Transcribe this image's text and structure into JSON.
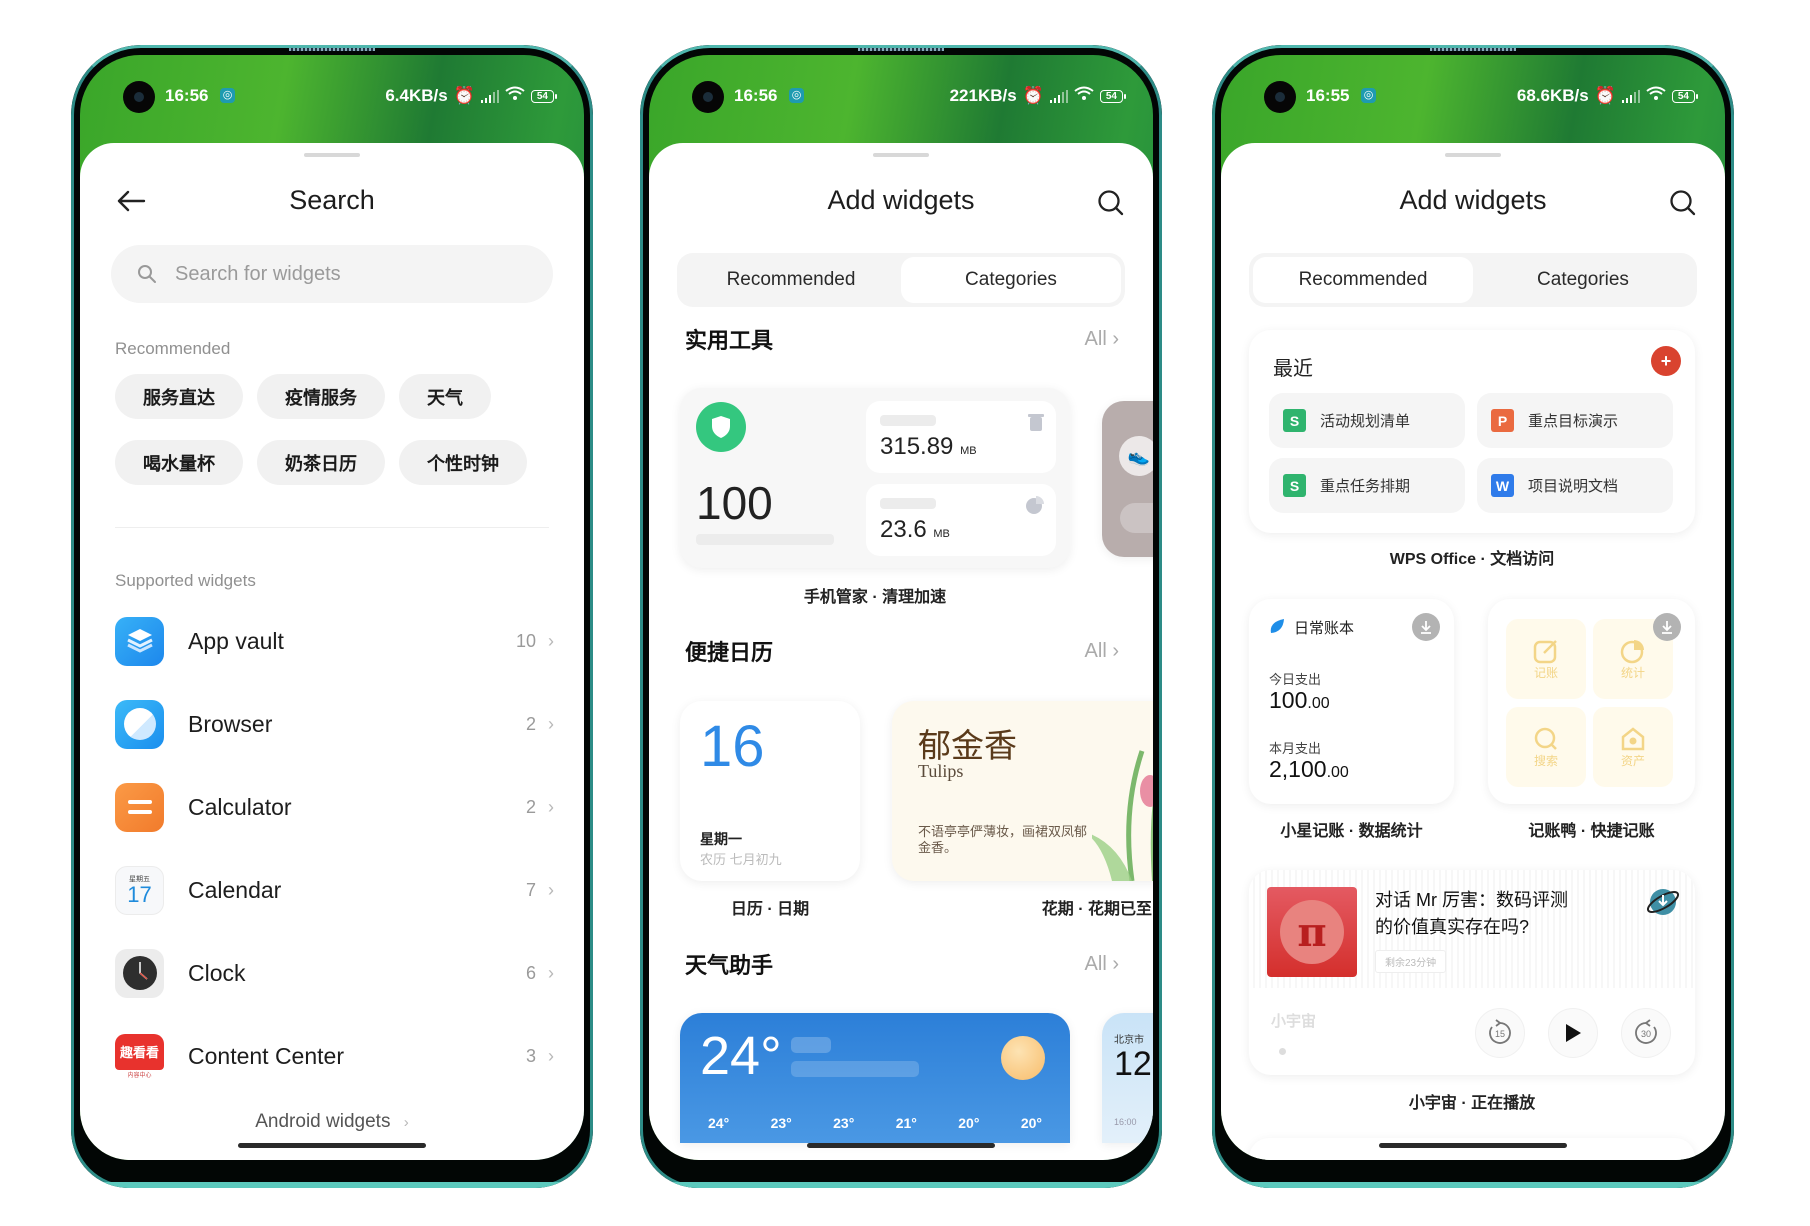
{
  "phones": [
    {
      "status": {
        "time": "16:56",
        "net_speed": "6.4KB/s",
        "battery": "54"
      },
      "header": {
        "title": "Search",
        "back_icon": "arrow-left-icon"
      },
      "search": {
        "placeholder": "Search for widgets",
        "value": ""
      },
      "recommended": {
        "label": "Recommended",
        "chips": [
          "服务直达",
          "疫情服务",
          "天气",
          "喝水量杯",
          "奶茶日历",
          "个性时钟"
        ]
      },
      "supported": {
        "label": "Supported widgets",
        "items": [
          {
            "name": "App vault",
            "count": "10",
            "icon": "app-vault-icon",
            "color": "#2f9bf0"
          },
          {
            "name": "Browser",
            "count": "2",
            "icon": "browser-icon",
            "color": "#26a3f2"
          },
          {
            "name": "Calculator",
            "count": "2",
            "icon": "calculator-icon",
            "color": "#f58a35"
          },
          {
            "name": "Calendar",
            "count": "7",
            "icon": "calendar-icon",
            "weekday": "星期五",
            "day": "17",
            "color": "#1f8bdc"
          },
          {
            "name": "Clock",
            "count": "6",
            "icon": "clock-icon",
            "color": "#2e2e2e"
          },
          {
            "name": "Content Center",
            "count": "3",
            "icon": "content-center-icon",
            "icon_text": "趣看看",
            "icon_sub": "内容中心",
            "color": "#e8322d"
          }
        ]
      },
      "android_widgets_label": "Android widgets"
    },
    {
      "status": {
        "time": "16:56",
        "net_speed": "221KB/s",
        "battery": "54"
      },
      "header": {
        "title": "Add widgets"
      },
      "tabs": [
        {
          "label": "Recommended",
          "active": false
        },
        {
          "label": "Categories",
          "active": true
        }
      ],
      "sections": [
        {
          "title": "实用工具",
          "all_label": "All",
          "widgets": [
            {
              "caption": "手机管家 · 清理加速",
              "score": "100",
              "junk_value": "315.89",
              "junk_unit": "MB",
              "mem_value": "23.6",
              "mem_unit": "MB"
            }
          ]
        },
        {
          "title": "便捷日历",
          "all_label": "All",
          "widgets": [
            {
              "caption": "日历 · 日期",
              "day": "16",
              "weekday": "星期一",
              "lunar": "农历 七月初九"
            },
            {
              "caption": "花期 · 花期已至",
              "flower_cn": "郁金香",
              "flower_en": "Tulips",
              "poem": "不语亭亭俨薄妆，画裙双凤郁金香。"
            }
          ]
        },
        {
          "title": "天气助手",
          "all_label": "All",
          "widgets": [
            {
              "current_temp": "24°",
              "hourly_temps": [
                "24°",
                "23°",
                "23°",
                "21°",
                "20°",
                "20°"
              ]
            },
            {
              "city": "北京市",
              "temp": "12",
              "time": "16:00"
            }
          ]
        }
      ]
    },
    {
      "status": {
        "time": "16:55",
        "net_speed": "68.6KB/s",
        "battery": "54"
      },
      "header": {
        "title": "Add widgets"
      },
      "tabs": [
        {
          "label": "Recommended",
          "active": true
        },
        {
          "label": "Categories",
          "active": false
        }
      ],
      "wps": {
        "title": "最近",
        "docs": [
          {
            "type": "S",
            "name": "活动规划清单",
            "color": "#2fb46e"
          },
          {
            "type": "P",
            "name": "重点目标演示",
            "color": "#ea6a40"
          },
          {
            "type": "S",
            "name": "重点任务排期",
            "color": "#2fb46e"
          },
          {
            "type": "W",
            "name": "项目说明文档",
            "color": "#2f7bea"
          }
        ],
        "caption": "WPS Office · 文档访问"
      },
      "ledger": {
        "title": "日常账本",
        "today_label": "今日支出",
        "today_int": "100",
        "today_dec": ".00",
        "month_label": "本月支出",
        "month_int": "2,100",
        "month_dec": ".00",
        "caption": "小星记账 · 数据统计"
      },
      "quick": {
        "tiles": [
          "记账",
          "统计",
          "搜索",
          "资产"
        ],
        "caption": "记账鸭 · 快捷记账"
      },
      "podcast": {
        "title": "对话 Mr 厉害：数码评测的价值真实存在吗?",
        "title_line1": "对话 Mr 厉害：数码评测",
        "title_line2": "的价值真实存在吗?",
        "remaining": "剩余23分钟",
        "app": "小宇宙",
        "rewind": "15",
        "forward": "30",
        "caption": "小宇宙 · 正在播放"
      }
    }
  ]
}
